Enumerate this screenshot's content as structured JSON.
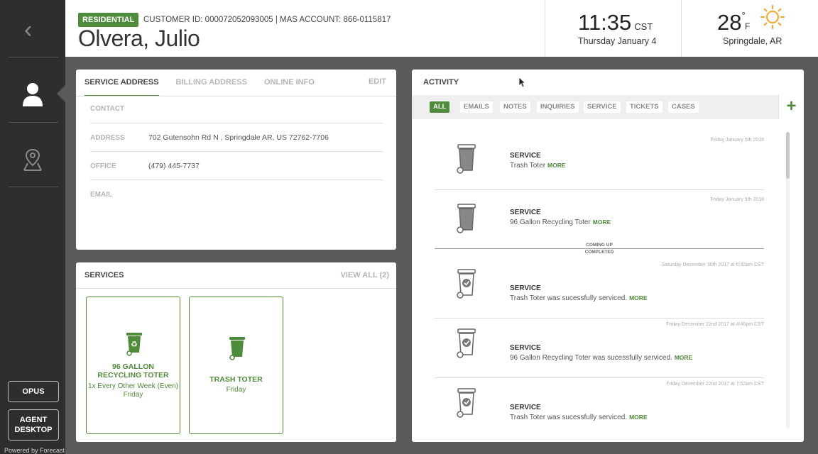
{
  "rail": {
    "buttons": {
      "opus": "OPUS",
      "agent_desktop_line1": "AGENT",
      "agent_desktop_line2": "DESKTOP"
    },
    "powered_by": "Powered by Forecast"
  },
  "header": {
    "badge": "RESIDENTIAL",
    "customer_info": "CUSTOMER ID: 000072052093005  |  MAS ACCOUNT: 866-0115817",
    "customer_name": "Olvera, Julio",
    "time": "11:35",
    "timezone": "CST",
    "date": "Thursday January 4",
    "temperature": "28",
    "temp_unit": "F",
    "location": "Springdale, AR"
  },
  "address_panel": {
    "tabs": [
      "SERVICE ADDRESS",
      "BILLING ADDRESS",
      "ONLINE INFO"
    ],
    "edit_label": "EDIT",
    "rows": [
      {
        "label": "CONTACT",
        "value": ""
      },
      {
        "label": "ADDRESS",
        "value": "702 Gutensohn Rd N , Springdale AR, US 72762-7706"
      },
      {
        "label": "OFFICE",
        "value": "(479) 445-7737"
      },
      {
        "label": "EMAIL",
        "value": ""
      }
    ]
  },
  "services_panel": {
    "title": "SERVICES",
    "view_all": "VIEW ALL (2)",
    "cards": [
      {
        "title_line1": "96 GALLON",
        "title_line2": "RECYCLING TOTER",
        "schedule_line1": "1x Every Other Week (Even)",
        "schedule_line2": "Friday",
        "icon": "recycling-toter-icon"
      },
      {
        "title_line1": "TRASH TOTER",
        "title_line2": "",
        "schedule_line1": "Friday",
        "schedule_line2": "",
        "icon": "trash-toter-icon"
      }
    ]
  },
  "activity_panel": {
    "title": "ACTIVITY",
    "filters": [
      "ALL",
      "EMAILS",
      "NOTES",
      "INQUIRIES",
      "SERVICE",
      "TICKETS",
      "CASES"
    ],
    "active_filter": "ALL",
    "add_label": "+",
    "coming_up": "COMING UP",
    "completed": "COMPLETED",
    "more_label": "MORE",
    "items": [
      {
        "date": "Friday January 5th 2018",
        "type": "SERVICE",
        "description": "Trash Toter",
        "status": "upcoming"
      },
      {
        "date": "Friday January 5th 2018",
        "type": "SERVICE",
        "description": "96 Gallon Recycling Toter",
        "status": "upcoming"
      },
      {
        "date": "Saturday December 30th 2017 at 6:32am CST",
        "type": "SERVICE",
        "description": "Trash Toter was sucessfully serviced.",
        "status": "completed"
      },
      {
        "date": "Friday December 22nd 2017 at 4:46pm CST",
        "type": "SERVICE",
        "description": "96 Gallon Recycling Toter was sucessfully serviced.",
        "status": "completed"
      },
      {
        "date": "Friday December 22nd 2017 at 7:52am CST",
        "type": "SERVICE",
        "description": "Trash Toter was sucessfully serviced.",
        "status": "completed"
      }
    ]
  },
  "colors": {
    "accent": "#4e8b3a",
    "rail": "#2e2e2e",
    "backdrop": "#5a5a5a"
  }
}
